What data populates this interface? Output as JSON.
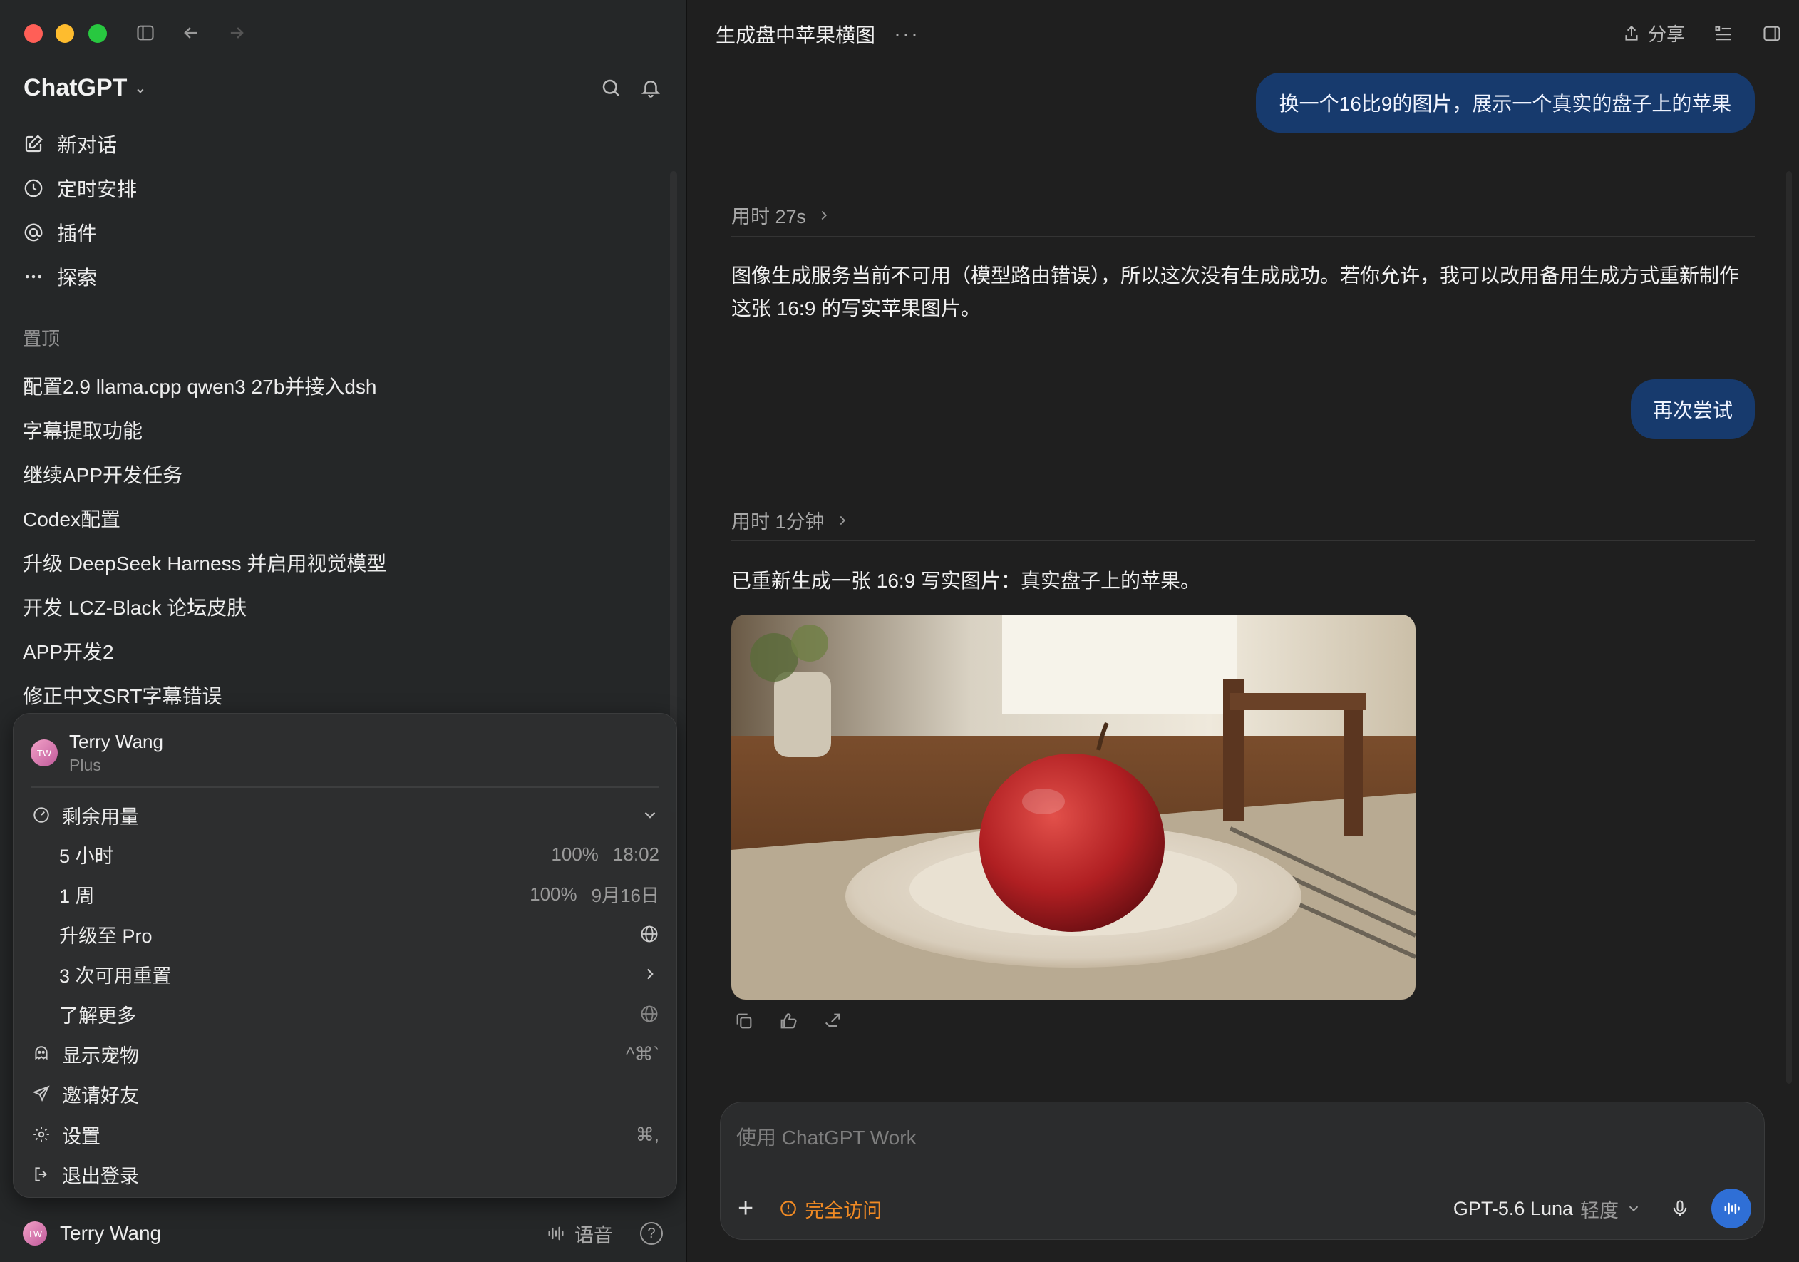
{
  "window": {
    "app_title": "ChatGPT",
    "chat_title": "生成盘中苹果横图",
    "share_label": "分享"
  },
  "colors": {
    "accent": "#173a6d",
    "voice_button": "#2f6fd6",
    "warning": "#f08a24"
  },
  "sidebar": {
    "nav": [
      {
        "label": "新对话",
        "icon": "edit-icon"
      },
      {
        "label": "定时安排",
        "icon": "clock-icon"
      },
      {
        "label": "插件",
        "icon": "at-icon"
      },
      {
        "label": "探索",
        "icon": "ellipsis-icon"
      }
    ],
    "pinned_label": "置顶",
    "pinned": [
      "配置2.9 llama.cpp qwen3 27b并接入dsh",
      "字幕提取功能",
      "继续APP开发任务",
      "Codex配置",
      "升级 DeepSeek Harness 并启用视觉模型",
      "开发 LCZ-Black 论坛皮肤",
      "APP开发2",
      "修正中文SRT字幕错误"
    ]
  },
  "menu": {
    "user_name": "Terry Wang",
    "user_plan": "Plus",
    "avatar_initials": "TW",
    "usage_label": "剩余用量",
    "usage": [
      {
        "label": "5 小时",
        "percent": "100%",
        "reset": "18:02"
      },
      {
        "label": "1 周",
        "percent": "100%",
        "reset": "9月16日"
      }
    ],
    "upgrade_label": "升级至 Pro",
    "resets_label": "3 次可用重置",
    "learn_more_label": "了解更多",
    "pet_label": "显示宠物",
    "pet_shortcut": "^⌘`",
    "invite_label": "邀请好友",
    "settings_label": "设置",
    "settings_shortcut": "⌘,",
    "logout_label": "退出登录"
  },
  "bottom": {
    "user_name": "Terry Wang",
    "voice_label": "语音"
  },
  "chat": {
    "user_msg_1": "换一个16比9的图片，展示一个真实的盘子上的苹果",
    "thought_1": "用时 27s",
    "assistant_msg_1": "图像生成服务当前不可用（模型路由错误），所以这次没有生成成功。若你允许，我可以改用备用生成方式重新制作这张 16:9 的写实苹果图片。",
    "user_msg_2": "再次尝试",
    "thought_2": "用时 1分钟",
    "assistant_msg_2": "已重新生成一张 16:9 写实图片：真实盘子上的苹果。"
  },
  "composer": {
    "placeholder": "使用 ChatGPT Work",
    "access_label": "完全访问",
    "model_name": "GPT-5.6 Luna",
    "model_effort": "轻度"
  }
}
